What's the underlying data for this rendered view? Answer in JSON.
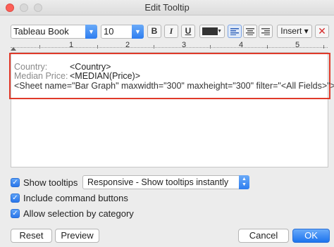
{
  "window": {
    "title": "Edit Tooltip"
  },
  "toolbar": {
    "font_family": "Tableau Book",
    "font_size": "10",
    "bold_label": "B",
    "italic_label": "I",
    "underline_label": "U",
    "text_color": "#333333",
    "insert_label": "Insert",
    "insert_caret": "▾",
    "clear_label": "✕"
  },
  "ruler": {
    "numbers": [
      "1",
      "2",
      "3",
      "4",
      "5"
    ]
  },
  "editor": {
    "line1_label": "Country:",
    "line1_field": "<Country>",
    "line2_label": "Median Price:",
    "line2_field": "<MEDIAN(Price)>",
    "line3": "<Sheet name=\"Bar Graph\" maxwidth=\"300\" maxheight=\"300\" filter=\"<All Fields>\">"
  },
  "options": {
    "show_tooltips": {
      "label": "Show tooltips",
      "checked": true
    },
    "tooltip_mode": "Responsive - Show tooltips instantly",
    "include_command_buttons": {
      "label": "Include command buttons",
      "checked": true
    },
    "allow_selection": {
      "label": "Allow selection by category",
      "checked": true
    }
  },
  "buttons": {
    "reset": "Reset",
    "preview": "Preview",
    "cancel": "Cancel",
    "ok": "OK"
  },
  "colors": {
    "accent": "#2d7df0",
    "highlight_border": "#e03a2a"
  }
}
